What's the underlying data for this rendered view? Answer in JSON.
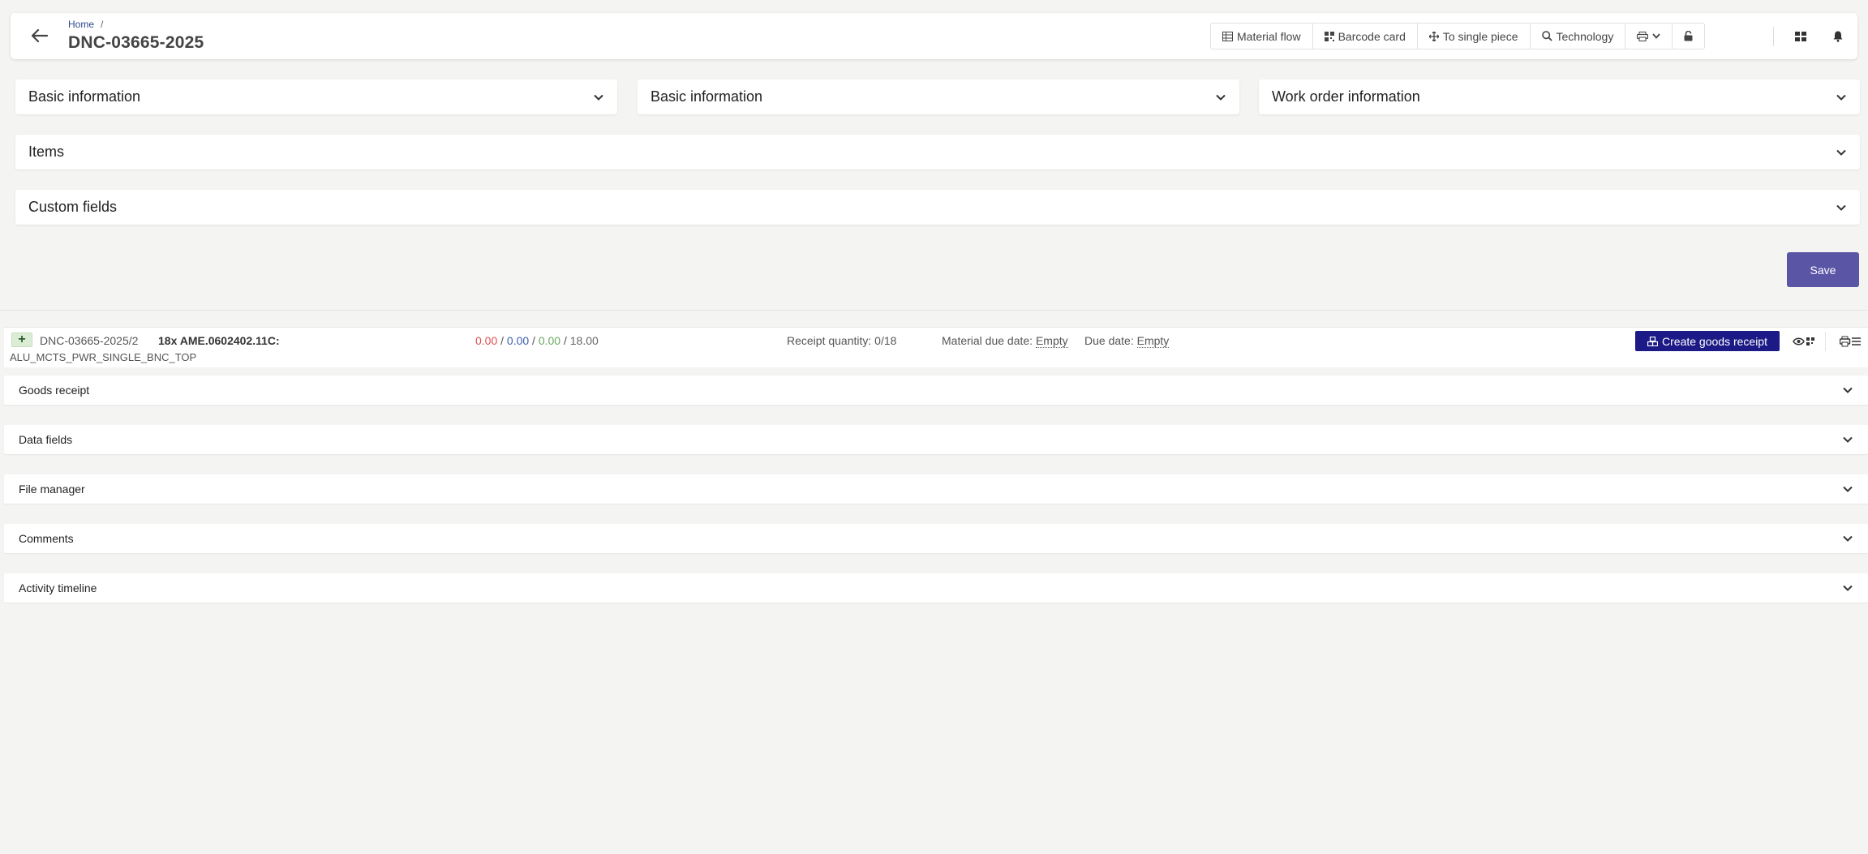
{
  "header": {
    "breadcrumb_home": "Home",
    "breadcrumb_sep": "/",
    "title": "DNC-03665-2025",
    "toolbar": [
      {
        "label": "Material flow",
        "icon": "table-icon"
      },
      {
        "label": "Barcode card",
        "icon": "barcode-icon"
      },
      {
        "label": "To single piece",
        "icon": "arrows-icon"
      },
      {
        "label": "Technology",
        "icon": "search-icon"
      }
    ]
  },
  "panels": {
    "basic_info_1": "Basic information",
    "basic_info_2": "Basic information",
    "work_order": "Work order information",
    "items": "Items",
    "custom_fields": "Custom fields"
  },
  "save_label": "Save",
  "item": {
    "plus": "+",
    "id": "DNC-03665-2025/2",
    "qty_text": "18x AME.0602402.11C:",
    "sub": "ALU_MCTS_PWR_SINGLE_BNC_TOP",
    "q1": "0.00",
    "q2": "0.00",
    "q3": "0.00",
    "q4": "18.00",
    "slash": " / ",
    "receipt": "Receipt quantity: 0/18",
    "material_due_label": "Material due date:",
    "material_due_value": "Empty",
    "due_label": "Due date:",
    "due_value": "Empty",
    "create_label": "Create goods receipt"
  },
  "sections": [
    "Goods receipt",
    "Data fields",
    "File manager",
    "Comments",
    "Activity timeline"
  ],
  "colors": {
    "accent": "#5b55a6",
    "primary_dark": "#1b1a86",
    "red": "#e05050",
    "blue": "#3d5fb0",
    "green": "#6aa860"
  }
}
